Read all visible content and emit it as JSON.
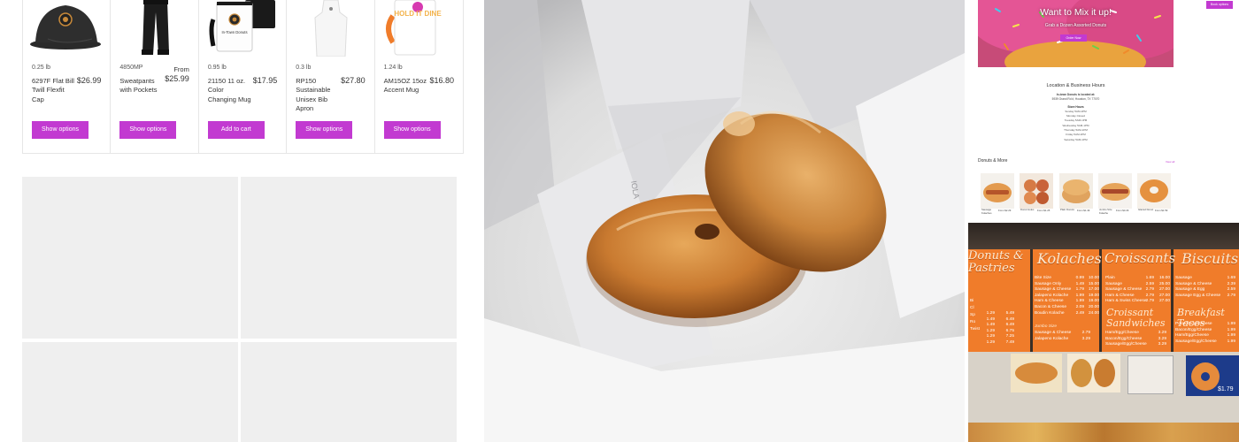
{
  "store": {
    "products": [
      {
        "weight": "0.25 lb",
        "name": "6297F Flat Bill Twill Flexfit Cap",
        "price_prefix": "",
        "price": "$26.99",
        "button": "Show options",
        "image": "black-cap"
      },
      {
        "weight": "4850MP",
        "name": "Sweatpants with Pockets",
        "price_prefix": "From",
        "price": "$25.99",
        "button": "Show options",
        "image": "black-sweatpants"
      },
      {
        "weight": "0.95 lb",
        "name": "21150 11 oz. Color Changing Mug",
        "price_prefix": "",
        "price": "$17.95",
        "button": "Add to cart",
        "image": "color-changing-mug",
        "mug_text": "In-Town Donuts"
      },
      {
        "weight": "0.3 lb",
        "name": "RP150 Sustainable Unisex Bib Apron",
        "price_prefix": "",
        "price": "$27.80",
        "button": "Show options",
        "image": "white-apron"
      },
      {
        "weight": "1.24 lb",
        "name": "AM15OZ 15oz Accent Mug",
        "price_prefix": "",
        "price": "$16.80",
        "button": "Show options",
        "image": "accent-mug",
        "mug_text": "HOLD IT DINE"
      }
    ]
  },
  "photo": {
    "bag_text": "IOLA"
  },
  "site": {
    "top_button": "Book options",
    "hero_title": "Want to Mix it up!",
    "hero_subtitle": "Grab a Dozen Assorted Donuts",
    "hero_button": "Order Now",
    "location_title": "Location & Business Hours",
    "address_line1": "In-town Donuts is located at:",
    "address_line2": "5939 Grand Rd #, Houston, TX 77070",
    "hours_title": "Store Hours",
    "hours": [
      "Sunday 5AM-1PM",
      "Monday Closed",
      "Tuesday 5AM-1PM",
      "Wednesday 5AM-1PM",
      "Thursday 5AM-1PM",
      "Friday 5AM-1PM",
      "Saturday 5AM-1PM"
    ],
    "more_title": "Donuts & More",
    "view_all": "View all",
    "items": [
      {
        "name": "Sausage Kolaches",
        "price": "From $2.29"
      },
      {
        "name": "Donut Holes",
        "price": "From $1.25"
      },
      {
        "name": "Plain Donuts",
        "price": "From $1.49"
      },
      {
        "name": "Jumbo Size Kolache",
        "price": "From $3.29"
      },
      {
        "name": "Glazed Donut",
        "price": "From $1.59"
      }
    ]
  },
  "board": {
    "headers": [
      "Donuts & Pastries",
      "Kolaches",
      "Croissants",
      "Biscuits"
    ],
    "sub_headers": [
      "Croissant Sandwiches",
      "Breakfast Tacos"
    ],
    "kolache_items": [
      "Bite Size",
      "Sausage Only",
      "Sausage & Cheese",
      "Jalapeno Kolache",
      "Ham & Cheese",
      "Bacon & Cheese",
      "Boudin Kolache"
    ],
    "kolache_prices": [
      "0.99",
      "1.49",
      "1.79",
      "1.99",
      "1.99",
      "2.09",
      "2.49"
    ],
    "kolache_dozen": [
      "10.00",
      "15.00",
      "17.00",
      "19.00",
      "19.00",
      "20.00",
      "24.00"
    ],
    "croissant_items": [
      "Plain",
      "Sausage",
      "Sausage & Cheese",
      "Ham & Cheese",
      "Ham & Swiss Cheese"
    ],
    "croissant_prices": [
      "1.69",
      "2.59",
      "2.79",
      "2.79",
      "2.79"
    ],
    "croissant_dozen": [
      "16.00",
      "25.00",
      "27.00",
      "27.00",
      "27.00"
    ],
    "biscuit_items": [
      "Sausage",
      "Sausage & Cheese",
      "Sausage & Egg",
      "Sausage Egg & Cheese"
    ],
    "biscuit_prices": [
      "1.69",
      "2.39",
      "2.59",
      "2.79"
    ],
    "jumbo_label": "Jumbo Size",
    "jumbo_items": [
      "Sausage & Cheese",
      "Jalapeno Kolache"
    ],
    "jumbo_prices": [
      "2.79",
      "3.29"
    ],
    "sandwich_items": [
      "Ham/Egg/Cheese",
      "Bacon/Egg/Cheese",
      "Sausage/Egg/Cheese"
    ],
    "sandwich_prices": [
      "3.29",
      "3.29",
      "3.29"
    ],
    "taco_items": [
      "Potato/Egg/Cheese",
      "Bacon/Egg/Cheese",
      "Ham/Egg/Cheese",
      "Sausage/Egg/Cheese"
    ],
    "taco_prices": [
      "1.99",
      "1.99",
      "1.99",
      "1.99"
    ],
    "donut_prices": [
      "1.29",
      "1.49",
      "1.49",
      "1.29",
      "1.29",
      "1.29"
    ],
    "donut_dozen": [
      "5.49",
      "6.49",
      "6.49",
      "6.75",
      "7.25",
      "7.49"
    ],
    "donut_labels": [
      "Bi",
      "Cl",
      "Sp",
      "Ro",
      "Twist"
    ],
    "corner_price": "$1.79"
  }
}
